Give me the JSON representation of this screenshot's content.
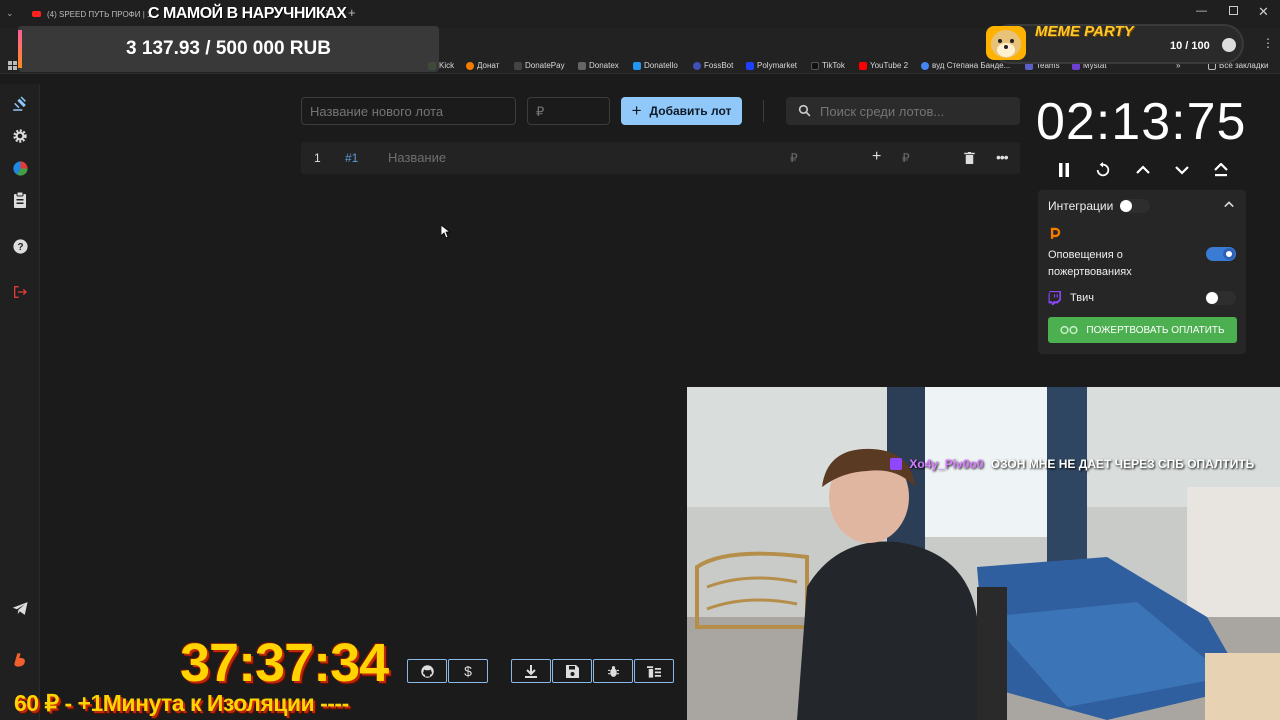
{
  "browser": {
    "tab_title": "(4) SPEED ПУТЬ ПРОФИ | 1",
    "tab_close": "×",
    "new_tab": "+",
    "bookmarks": [
      {
        "label": "Kick",
        "color": "#53fc18"
      },
      {
        "label": "Донат",
        "color": "#f57c00"
      },
      {
        "label": "DonatePay",
        "color": "#444444"
      },
      {
        "label": "Donatex",
        "color": "#666666"
      },
      {
        "label": "Donatello",
        "color": "#2196f3"
      },
      {
        "label": "FossBot",
        "color": "#3f51b5"
      },
      {
        "label": "Polymarket",
        "color": "#1e40ff"
      },
      {
        "label": "TikTok",
        "color": "#111111"
      },
      {
        "label": "YouTube 2",
        "color": "#ff0000"
      },
      {
        "label": "вуд Степана Банде...",
        "color": "#4285f4"
      },
      {
        "label": "Teams",
        "color": "#5b5fc7"
      },
      {
        "label": "Mystat",
        "color": "#6a3fd1"
      }
    ],
    "bookmarks_more": "»",
    "all_bookmarks": "Все закладки"
  },
  "overlay": {
    "stream_title": "С МАМОЙ В НАРУЧНИКАХ",
    "donation_goal": "3 137.93 / 500 000 RUB",
    "meme_party_title": "MEME PARTY",
    "meme_party_count": "10 / 100",
    "big_timer": "37:37:34",
    "ticker": "60 ₽ - +1Минута к Изоляции ----"
  },
  "toolbar": {
    "lot_name_placeholder": "Название нового лота",
    "price_placeholder": "₽",
    "add_lot_label": "Добавить лот",
    "search_placeholder": "Поиск среди лотов..."
  },
  "lots": [
    {
      "index": "1",
      "id": "#1",
      "name_placeholder": "Название",
      "amount_placeholder": "₽",
      "add_placeholder": "₽"
    }
  ],
  "timer": {
    "value": "02:13:75"
  },
  "integrations": {
    "title": "Интеграции",
    "enabled": false,
    "donations_label": "Оповещения о пожертвованиях",
    "donations_enabled": true,
    "twitch_label": "Твич",
    "twitch_enabled": false,
    "donate_button": "ПОЖЕРТВОВАТЬ ОПЛАТИТЬ",
    "colors": {
      "accent": "#3a7bd5",
      "donate": "#4caf50",
      "twitch": "#9146ff",
      "donatepay": "#f57c00"
    }
  },
  "chat": {
    "user": "Xo4y_Piv0o0",
    "message": "ОЗОН МНЕ НЕ ДАЕТ ЧЕРЕЗ СПБ ОПАЛТИТЬ",
    "user_color": "#d77cff"
  },
  "icons": {
    "sidebar": [
      "gavel-icon",
      "gear-icon",
      "pie-chart-icon",
      "clipboard-icon",
      "help-icon",
      "logout-icon",
      "telegram-icon",
      "boosty-icon"
    ],
    "bottom_buttons": [
      "github-icon",
      "dollar-icon",
      "download-icon",
      "save-icon",
      "bug-icon",
      "clear-list-icon"
    ]
  },
  "accent_color": "#90c8f9"
}
